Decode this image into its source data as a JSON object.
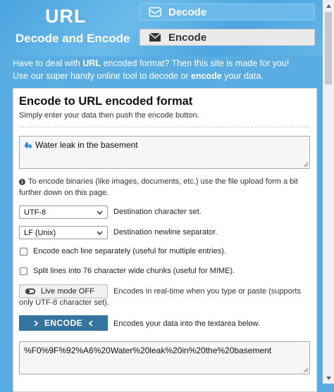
{
  "header": {
    "logo_title": "URL",
    "logo_subtitle": "Decode and Encode",
    "nav": [
      {
        "label": "Decode",
        "icon": "globe-icon",
        "active": false
      },
      {
        "label": "Encode",
        "icon": "envelope-icon",
        "active": true
      }
    ]
  },
  "intro": {
    "p1_a": "Have to deal with ",
    "p1_b": "URL",
    "p1_c": " encoded format? Then this site is made for you!",
    "p2_a": "Use our super handy online tool to decode or ",
    "p2_b": "encode",
    "p2_c": " your data."
  },
  "panel": {
    "title": "Encode to URL encoded format",
    "subtitle": "Simply enter your data then push the encode button.",
    "input_value": "Water leak in the basement",
    "input_icon": "droplet-emoji-icon",
    "note": "To encode binaries (like images, documents, etc.) use the file upload form a bit further down on this page.",
    "charset": {
      "value": "UTF-8",
      "label": "Destination character set."
    },
    "newline": {
      "value": "LF (Unix)",
      "label": "Destination newline separator."
    },
    "opt_each_line": {
      "label": "Encode each line separately (useful for multiple entries).",
      "checked": false
    },
    "opt_split": {
      "label": "Split lines into 76 character wide chunks (useful for MIME).",
      "checked": false
    },
    "live_mode": {
      "label": "Live mode OFF",
      "desc": "Encodes in real-time when you type or paste (supports only UTF-8 character set)."
    },
    "encode_button": {
      "label": "ENCODE",
      "desc": "Encodes your data into the textarea below."
    },
    "output_value": "%F0%9F%92%A6%20Water%20leak%20in%20the%20basement"
  },
  "colors": {
    "background": "#5aade3",
    "button": "#35749f"
  }
}
